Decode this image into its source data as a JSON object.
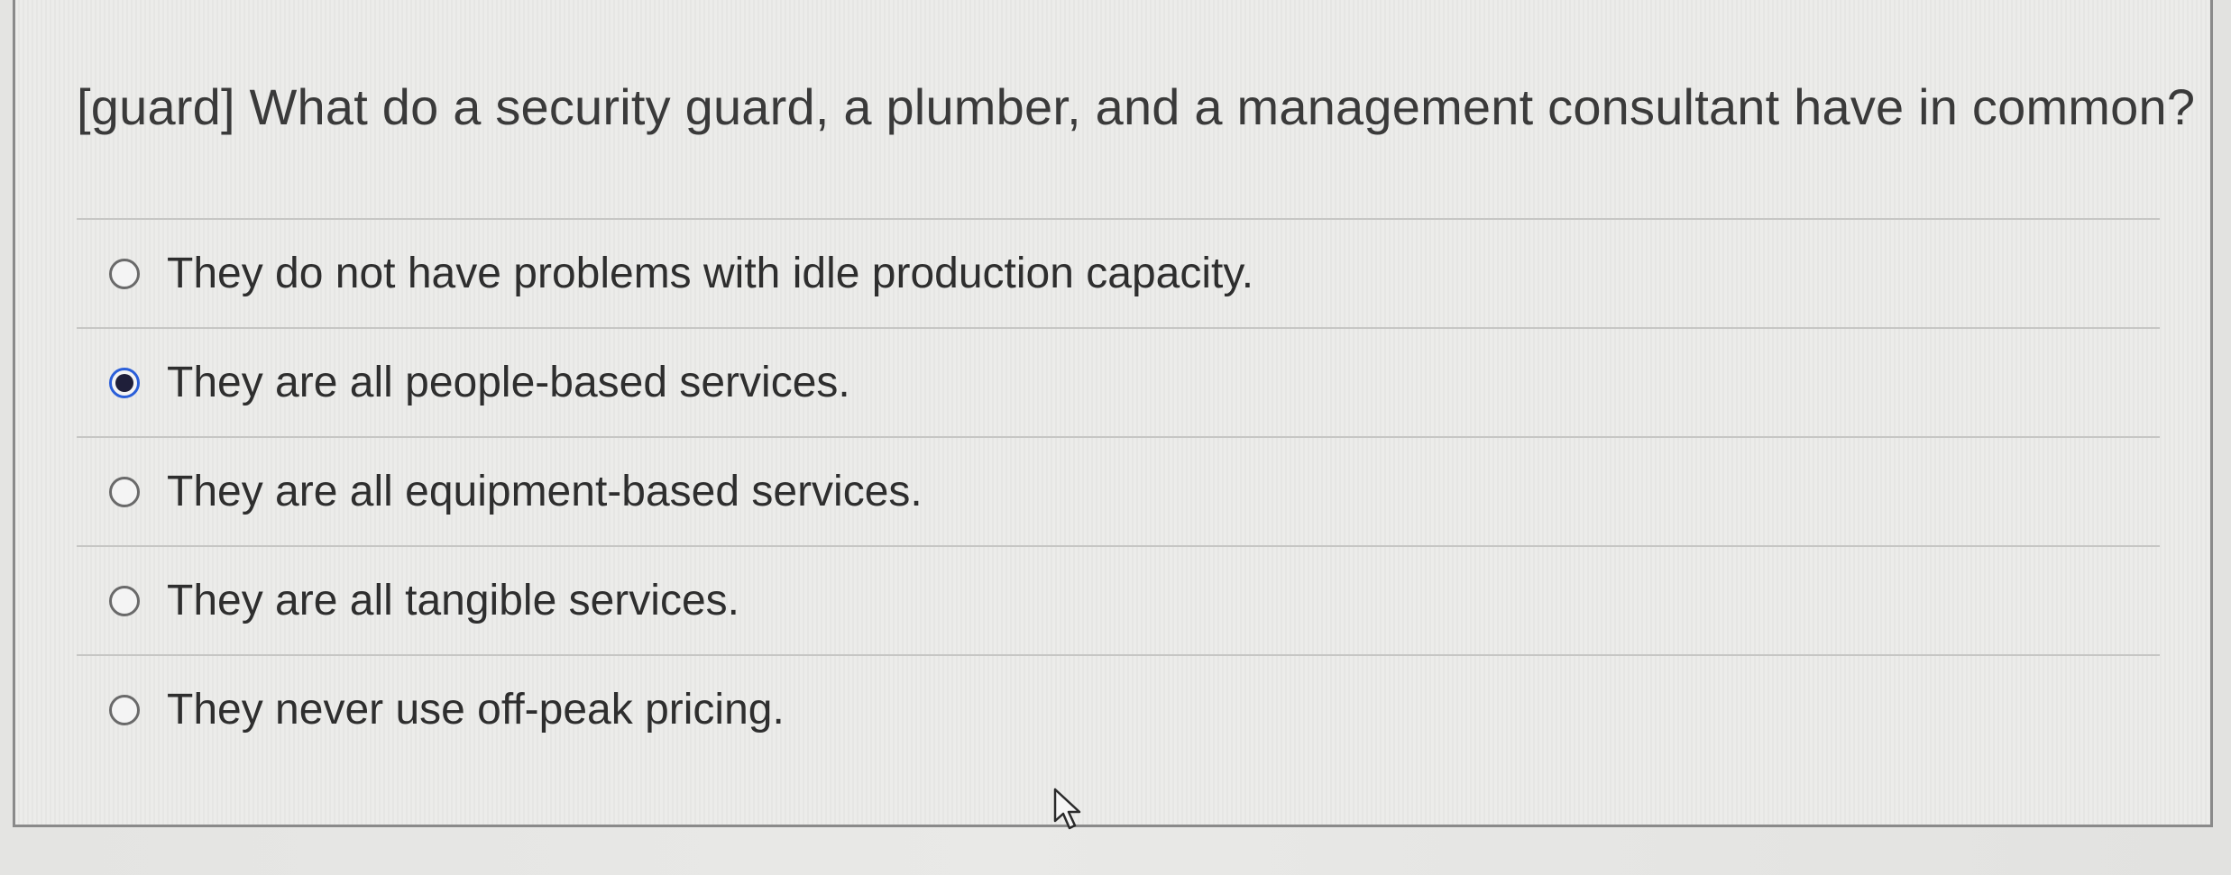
{
  "question": {
    "text": "[guard] What do a security guard, a plumber, and a management consultant have in common?"
  },
  "answers": [
    {
      "label": "They do not have problems with idle production capacity.",
      "selected": false
    },
    {
      "label": "They are all people-based services.",
      "selected": true
    },
    {
      "label": "They are all equipment-based services.",
      "selected": false
    },
    {
      "label": "They are all tangible services.",
      "selected": false
    },
    {
      "label": "They never use off-peak pricing.",
      "selected": false
    }
  ],
  "colors": {
    "radio_selected_ring": "#2b5fd9",
    "radio_selected_dot": "#1f1f3a",
    "text": "#2e2e2e"
  },
  "icons": {
    "cursor": "mouse-pointer-icon"
  }
}
